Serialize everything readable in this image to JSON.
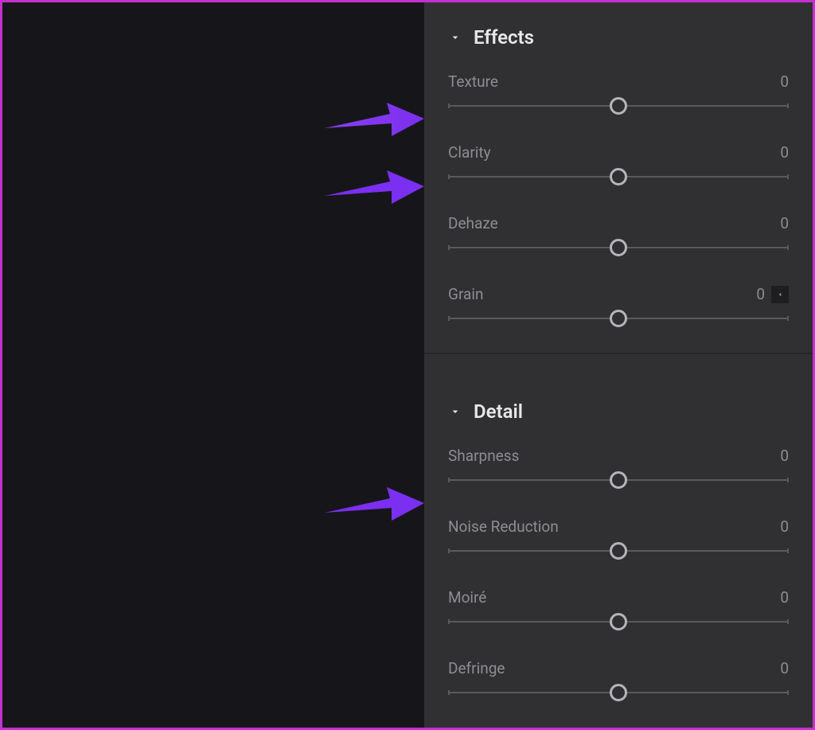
{
  "panels": {
    "effects": {
      "title": "Effects",
      "sliders": {
        "texture": {
          "label": "Texture",
          "value": "0"
        },
        "clarity": {
          "label": "Clarity",
          "value": "0"
        },
        "dehaze": {
          "label": "Dehaze",
          "value": "0"
        },
        "grain": {
          "label": "Grain",
          "value": "0"
        }
      }
    },
    "detail": {
      "title": "Detail",
      "sliders": {
        "sharpness": {
          "label": "Sharpness",
          "value": "0"
        },
        "noise_reduction": {
          "label": "Noise Reduction",
          "value": "0"
        },
        "moire": {
          "label": "Moiré",
          "value": "0"
        },
        "defringe": {
          "label": "Defringe",
          "value": "0"
        }
      }
    }
  }
}
